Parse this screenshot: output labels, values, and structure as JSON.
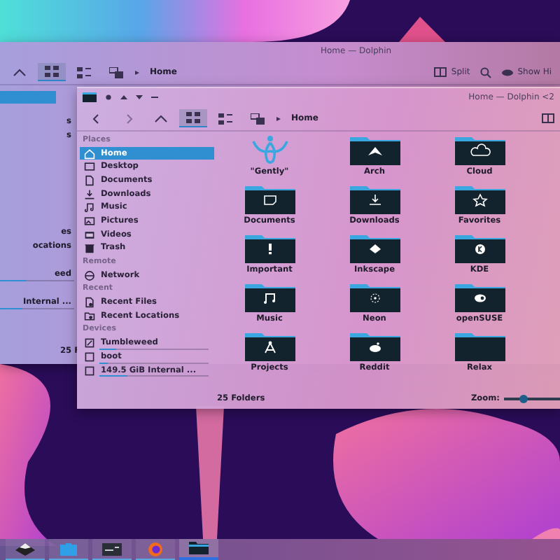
{
  "back_window": {
    "title": "Home — Dolphin",
    "breadcrumb": "Home",
    "split_label": "Split",
    "show_hidden_label": "Show Hi",
    "sidebar_fragments": [
      {
        "label": "s"
      },
      {
        "label": "s"
      },
      {
        "label": "es"
      },
      {
        "label": "ocations"
      },
      {
        "label": "eed",
        "level": 0.35
      },
      {
        "label": "Internal ...",
        "level": 0.3
      }
    ],
    "status": "25 F"
  },
  "window": {
    "title": "Home — Dolphin <2",
    "breadcrumb": "Home"
  },
  "view_modes": [
    {
      "selected": true
    },
    {
      "selected": false
    },
    {
      "selected": false
    }
  ],
  "sidebar": [
    {
      "header": "Places",
      "items": [
        {
          "label": "Home",
          "selected": true
        },
        {
          "label": "Desktop",
          "selected": false
        },
        {
          "label": "Documents",
          "selected": false
        },
        {
          "label": "Downloads",
          "selected": false
        },
        {
          "label": "Music",
          "selected": false
        },
        {
          "label": "Pictures",
          "selected": false
        },
        {
          "label": "Videos",
          "selected": false
        },
        {
          "label": "Trash",
          "selected": false
        }
      ]
    },
    {
      "header": "Remote",
      "items": [
        {
          "label": "Network",
          "selected": false
        }
      ]
    },
    {
      "header": "Recent",
      "items": [
        {
          "label": "Recent Files",
          "selected": false
        },
        {
          "label": "Recent Locations",
          "selected": false
        }
      ]
    },
    {
      "header": "Devices",
      "items": [
        {
          "label": "Tumbleweed",
          "selected": false,
          "level": 0.15
        },
        {
          "label": "boot",
          "selected": false,
          "level": 0.08
        },
        {
          "label": "149.5 GiB Internal ...",
          "selected": false,
          "level": 0.25
        }
      ]
    }
  ],
  "files": [
    {
      "name": "\"Gently\"",
      "kind": "logo"
    },
    {
      "name": "Arch",
      "kind": "folder"
    },
    {
      "name": "Cloud",
      "kind": "folder"
    },
    {
      "name": "Documents",
      "kind": "folder"
    },
    {
      "name": "Downloads",
      "kind": "folder"
    },
    {
      "name": "Favorites",
      "kind": "folder"
    },
    {
      "name": "Important",
      "kind": "folder"
    },
    {
      "name": "Inkscape",
      "kind": "folder"
    },
    {
      "name": "KDE",
      "kind": "folder"
    },
    {
      "name": "Music",
      "kind": "folder"
    },
    {
      "name": "Neon",
      "kind": "folder"
    },
    {
      "name": "openSUSE",
      "kind": "folder"
    },
    {
      "name": "Projects",
      "kind": "folder"
    },
    {
      "name": "Reddit",
      "kind": "folder"
    },
    {
      "name": "Relax",
      "kind": "folder"
    }
  ],
  "status_bar": {
    "text": "25 Folders",
    "zoom_label": "Zoom:",
    "zoom": {
      "level": 0.35
    }
  },
  "taskbar": [
    {
      "selected": false
    },
    {
      "selected": false
    },
    {
      "selected": false
    },
    {
      "selected": false
    },
    {
      "selected": true
    }
  ]
}
